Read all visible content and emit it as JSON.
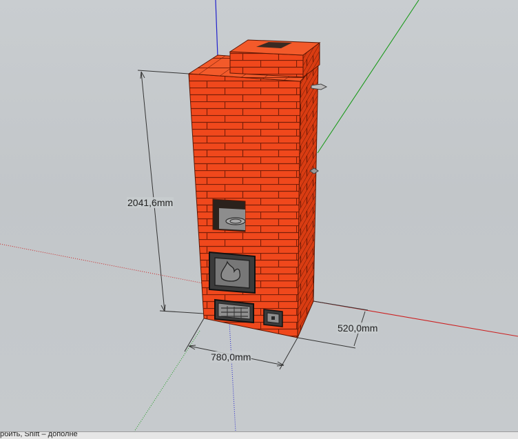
{
  "dimensions": {
    "height": "2041,6mm",
    "width": "780,0mm",
    "depth": "520,0mm"
  },
  "status_bar": {
    "text": "рбить, Shift – дополне"
  },
  "colors": {
    "brick_front": "#f0481c",
    "brick_side": "#d93c12",
    "brick_top": "#f35a2a",
    "mortar": "#7a1e08",
    "axis_red": "#cc2020",
    "axis_green": "#1a9a1a",
    "axis_blue": "#2020cc"
  },
  "icons": {
    "firebox_door": "flame-door-icon",
    "ash_door": "grate-door-icon",
    "cleanout_door": "cleanout-door-icon"
  }
}
